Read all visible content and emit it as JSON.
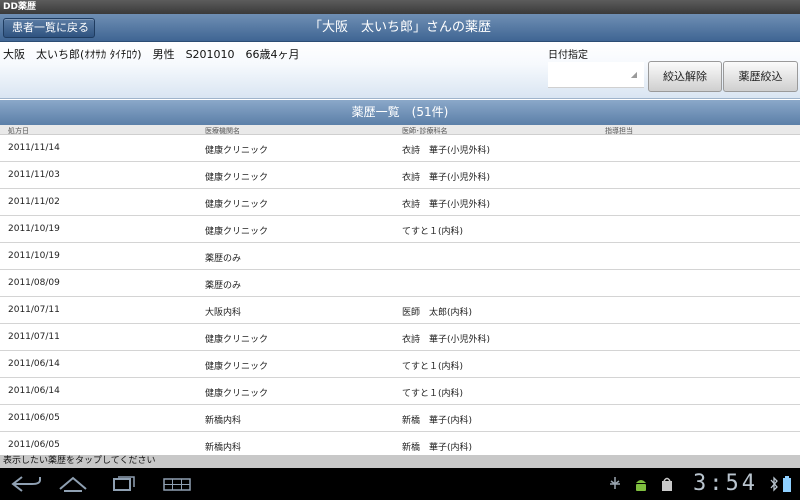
{
  "app": {
    "title": "DD薬歴"
  },
  "titlebar": {
    "back_label": "患者一覧に戻る",
    "title": "「大阪　太いち郎」さんの薬歴"
  },
  "patient": {
    "summary": "大阪　太いち郎(ｵｵｻｶ ﾀｲﾁﾛｳ)　男性　S201010　66歳4ヶ月"
  },
  "filter": {
    "date_label": "日付指定",
    "date_value": "",
    "clear_label": "絞込解除",
    "apply_label": "薬歴絞込"
  },
  "list": {
    "header": "薬歴一覧　(51件)",
    "columns": {
      "date": "処方日",
      "institution": "医療機関名",
      "doctor": "医師･診療科名",
      "staff": "指導担当"
    },
    "rows": [
      {
        "date": "2011/11/14",
        "institution": "健康クリニック",
        "doctor": "衣詩　華子(小児外科)",
        "staff": ""
      },
      {
        "date": "2011/11/03",
        "institution": "健康クリニック",
        "doctor": "衣詩　華子(小児外科)",
        "staff": ""
      },
      {
        "date": "2011/11/02",
        "institution": "健康クリニック",
        "doctor": "衣詩　華子(小児外科)",
        "staff": ""
      },
      {
        "date": "2011/10/19",
        "institution": "健康クリニック",
        "doctor": "てすと１(内科)",
        "staff": ""
      },
      {
        "date": "2011/10/19",
        "institution": "薬歴のみ",
        "doctor": "",
        "staff": ""
      },
      {
        "date": "2011/08/09",
        "institution": "薬歴のみ",
        "doctor": "",
        "staff": ""
      },
      {
        "date": "2011/07/11",
        "institution": "大阪内科",
        "doctor": "医師　太郎(内科)",
        "staff": ""
      },
      {
        "date": "2011/07/11",
        "institution": "健康クリニック",
        "doctor": "衣詩　華子(小児外科)",
        "staff": ""
      },
      {
        "date": "2011/06/14",
        "institution": "健康クリニック",
        "doctor": "てすと１(内科)",
        "staff": ""
      },
      {
        "date": "2011/06/14",
        "institution": "健康クリニック",
        "doctor": "てすと１(内科)",
        "staff": ""
      },
      {
        "date": "2011/06/05",
        "institution": "新橋内科",
        "doctor": "新橋　華子(内科)",
        "staff": ""
      },
      {
        "date": "2011/06/05",
        "institution": "新橋内科",
        "doctor": "新橋　華子(内科)",
        "staff": ""
      }
    ]
  },
  "status": {
    "message": "表示したい薬歴をタップしてください"
  },
  "system": {
    "clock": "3:54",
    "icons": [
      "usb-debug-icon",
      "android-icon",
      "shopping-bag-icon",
      "bluetooth-icon",
      "battery-icon"
    ]
  },
  "colors": {
    "titlebar": "#3f6593",
    "list_header": "#5b7fa8",
    "clock": "#b9c4ce"
  }
}
